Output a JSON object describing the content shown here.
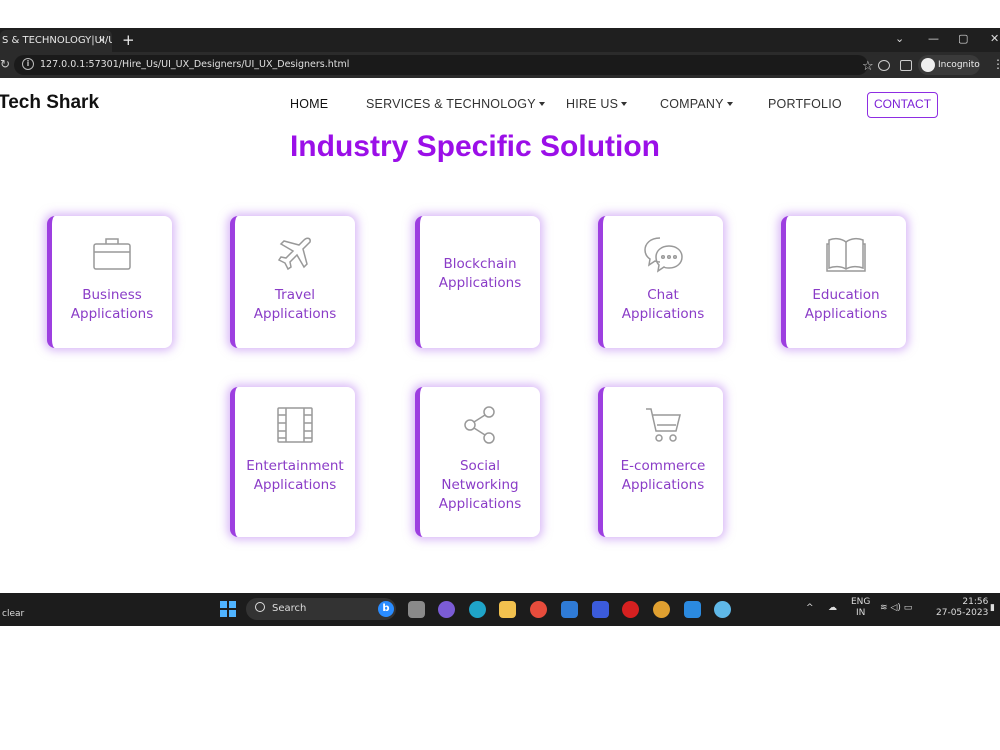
{
  "browser": {
    "tab_title": "S & TECHNOLOGY|UI/U",
    "tab_close": "×",
    "new_tab": "+",
    "url": "127.0.0.1:57301/Hire_Us/UI_UX_Designers/UI_UX_Designers.html",
    "incognito_label": "Incognito",
    "window_controls": [
      "⌄",
      "—",
      "▢",
      "✕"
    ]
  },
  "site": {
    "logo": "Tech Shark",
    "nav": {
      "home": "HOME",
      "services": "SERVICES & TECHNOLOGY",
      "hire": "HIRE US",
      "company": "COMPANY",
      "portfolio": "PORTFOLIO",
      "contact": "CONTACT"
    },
    "title": "Industry Specific Solution",
    "cards": [
      {
        "line1": "Business",
        "line2": "Applications",
        "icon": "briefcase-icon"
      },
      {
        "line1": "Travel",
        "line2": "Applications",
        "icon": "airplane-icon"
      },
      {
        "line1": "Blockchain",
        "line2": "Applications",
        "icon": "none"
      },
      {
        "line1": "Chat",
        "line2": "Applications",
        "icon": "chat-bubbles-icon"
      },
      {
        "line1": "Education",
        "line2": "Applications",
        "icon": "open-book-icon"
      },
      {
        "line1": "Entertainment",
        "line2": "Applications",
        "icon": "film-strip-icon"
      },
      {
        "line1": "Social",
        "line2": "Networking",
        "line3": "Applications",
        "icon": "share-icon"
      },
      {
        "line1": "E-commerce",
        "line2": "Applications",
        "icon": "shopping-cart-icon"
      }
    ],
    "accent_color": "#9b0fe8",
    "card_border_color": "#9d3fe0"
  },
  "taskbar": {
    "weather": "clear",
    "search_placeholder": "Search",
    "lang_line1": "ENG",
    "lang_line2": "IN",
    "time": "21:56",
    "date": "27-05-2023"
  }
}
